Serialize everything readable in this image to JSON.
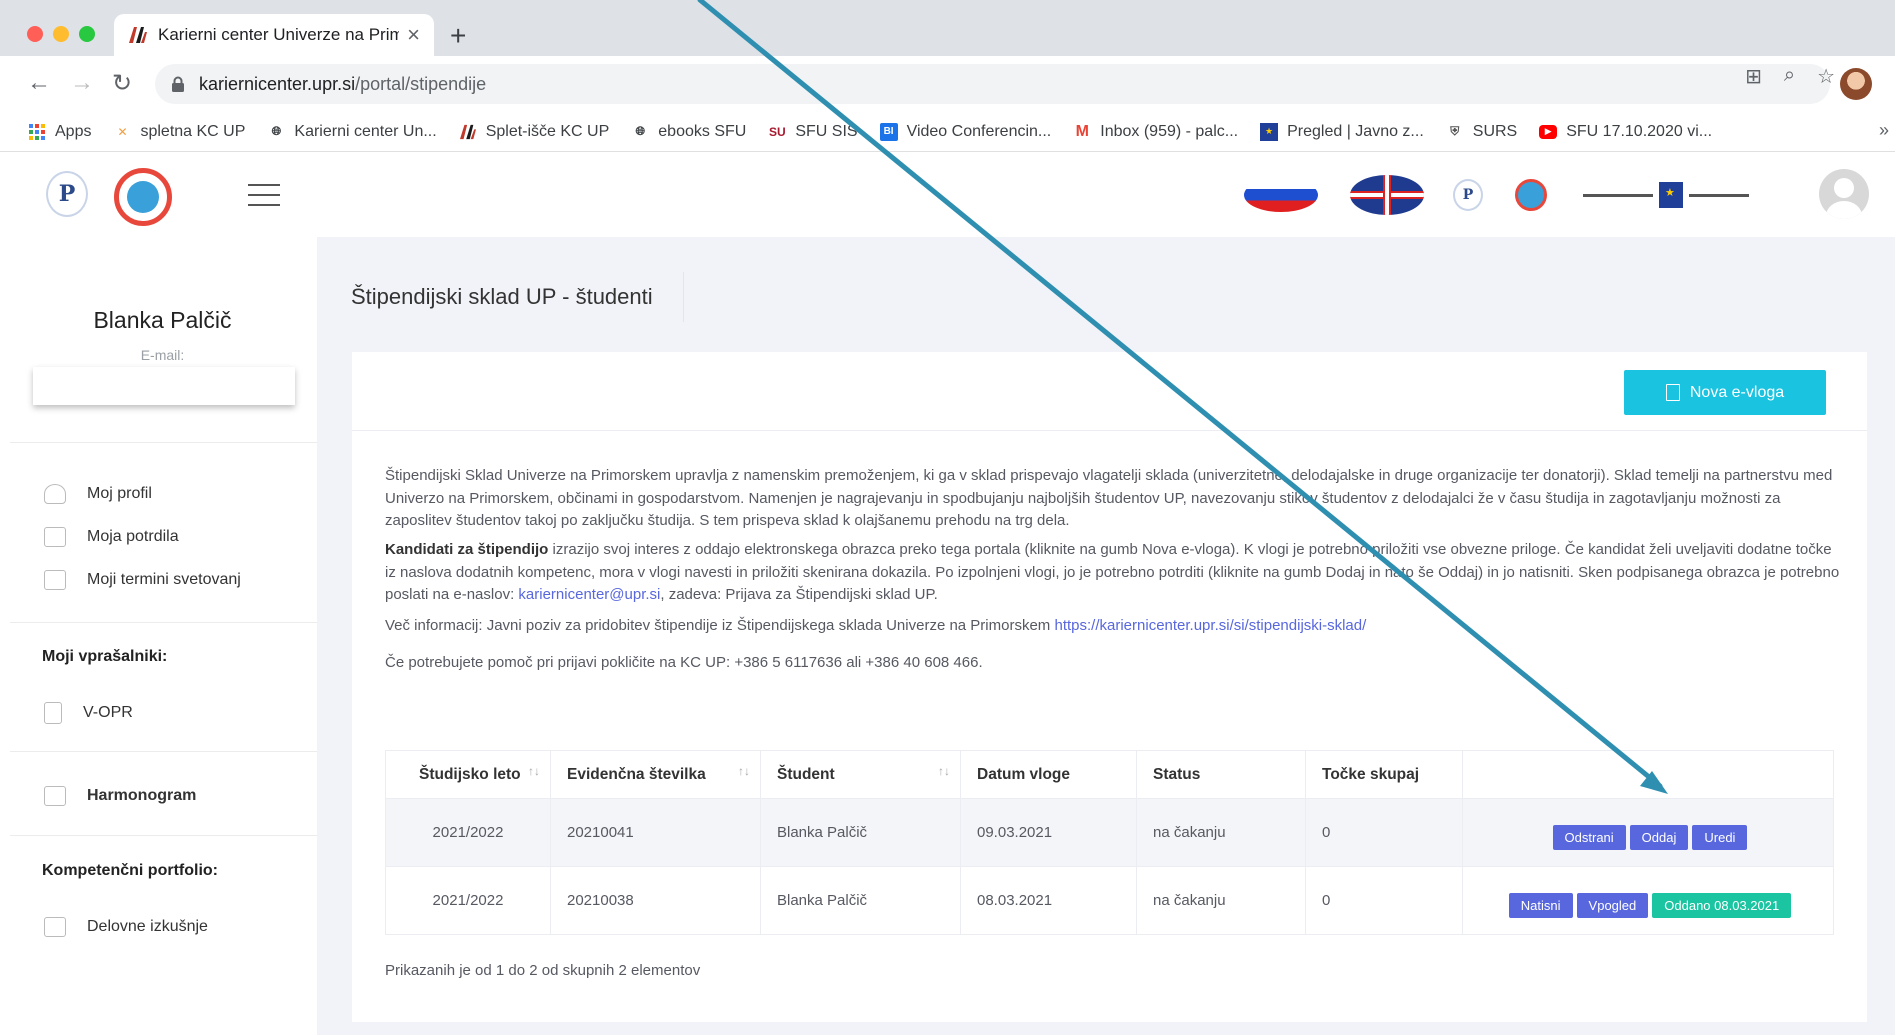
{
  "browser": {
    "tab_title": "Karierni center Univerze na Prim",
    "url_host": "kariernicenter.upr.si",
    "url_path": "/portal/stipendije",
    "bookmarks": [
      {
        "label": "Apps",
        "icon": "apps-grid-icon"
      },
      {
        "label": "spletna KC UP",
        "icon": "kc-up-icon"
      },
      {
        "label": "Karierni center Un...",
        "icon": "globe-icon"
      },
      {
        "label": "Splet-išče KC UP",
        "icon": "up-logo-icon"
      },
      {
        "label": "ebooks SFU",
        "icon": "globe-icon"
      },
      {
        "label": "SFU SIS",
        "icon": "sfu-icon"
      },
      {
        "label": "Video Conferencin...",
        "icon": "video-icon"
      },
      {
        "label": "Inbox (959) - palc...",
        "icon": "gmail-icon"
      },
      {
        "label": "Pregled | Javno z...",
        "icon": "eu-icon"
      },
      {
        "label": "SURS",
        "icon": "surs-icon"
      },
      {
        "label": "SFU 17.10.2020 vi...",
        "icon": "youtube-icon"
      }
    ],
    "more_bookmarks": "»"
  },
  "sidebar": {
    "user_name": "Blanka Palčič",
    "email_label": "E-mail:",
    "items": [
      {
        "label": "Moj profil"
      },
      {
        "label": "Moja potrdila"
      },
      {
        "label": "Moji termini svetovanj"
      }
    ],
    "questionnaires_title": "Moji vprašalniki:",
    "questionnaire_item": "V-OPR",
    "harmonogram": "Harmonogram",
    "portfolio_title": "Kompetenčni portfolio:",
    "portfolio_item": "Delovne izkušnje"
  },
  "main": {
    "page_title": "Štipendijski sklad UP - študenti",
    "new_button": "Nova e-vloga",
    "intro": "Štipendijski Sklad Univerze na Primorskem upravlja z namenskim premoženjem, ki ga v sklad prispevajo vlagatelji sklada (univerzitetne, delodajalske in druge organizacije ter donatorji). Sklad temelji na partnerstvu med Univerzo na Primorskem, občinami in gospodarstvom. Namenjen je nagrajevanju in spodbujanju najboljših študentov UP, navezovanju stikov študentov z delodajalci že v času študija in zagotavljanju možnosti za zaposlitev študentov takoj po zaključku študija. S tem prispeva sklad k olajšanemu prehodu na trg dela.",
    "candidates_bold": "Kandidati za štipendijo",
    "candidates_text": " izrazijo svoj interes z oddajo elektronskega obrazca preko tega portala (kliknite na gumb Nova e-vloga). K vlogi je potrebno priložiti vse obvezne priloge. Če kandidat želi uveljaviti dodatne točke iz naslova dodatnih kompetenc, mora v vlogi navesti in priložiti skenirana dokazila. Po izpolnjeni vlogi, jo je potrebno potrditi (kliknite na gumb Dodaj in nato še Oddaj) in jo natisniti. Sken podpisanega obrazca je potrebno poslati na e-naslov: ",
    "candidates_email": "kariernicenter@upr.si",
    "candidates_tail": ", zadeva: Prijava za Štipendijski sklad UP.",
    "more_info_text": "Več informacij: Javni poziv za pridobitev štipendije iz Štipendijskega sklada Univerze na Primorskem ",
    "more_info_link": "https://kariernicenter.upr.si/si/stipendijski-sklad/",
    "help_text": "Če potrebujete pomoč pri prijavi pokličite na KC UP: +386 5 6117636 ali +386 40 608 466.",
    "table": {
      "headers": [
        "Študijsko leto",
        "Evidenčna številka",
        "Študent",
        "Datum vloge",
        "Status",
        "Točke skupaj",
        ""
      ],
      "rows": [
        {
          "year": "2021/2022",
          "number": "20210041",
          "student": "Blanka Palčič",
          "date": "09.03.2021",
          "status": "na čakanju",
          "points": "0",
          "actions": [
            "Odstrani",
            "Oddaj",
            "Uredi"
          ]
        },
        {
          "year": "2021/2022",
          "number": "20210038",
          "student": "Blanka Palčič",
          "date": "08.03.2021",
          "status": "na čakanju",
          "points": "0",
          "actions": [
            "Natisni",
            "Vpogled",
            "Oddano 08.03.2021"
          ]
        }
      ]
    },
    "footer_info": "Prikazanih je od 1 do 2 od skupnih 2 elementov"
  },
  "colors": {
    "accent_cyan": "#1ac3e0",
    "action_purple": "#5867dd",
    "submitted_green": "#1bc5a1",
    "annotation_arrow": "#2e8fb0"
  }
}
